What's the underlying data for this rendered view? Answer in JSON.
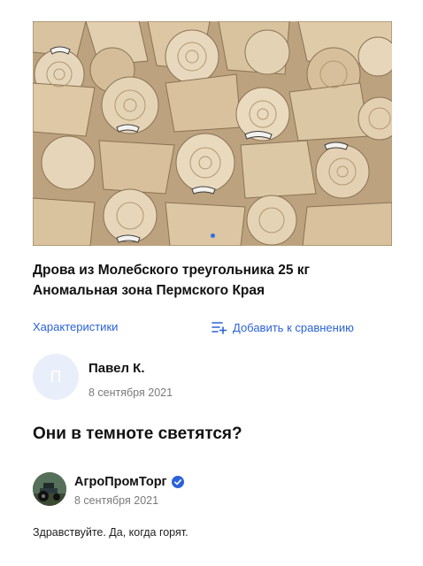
{
  "product": {
    "image_alt_icon": "firewood-photo",
    "title_line1": "Дрова из Молебского треугольника 25 кг",
    "title_line2": "Аномальная зона Пермского Края"
  },
  "actions": {
    "specs_label": "Характеристики",
    "compare_label": "Добавить к сравнению",
    "compare_icon": "add-to-compare-icon"
  },
  "review": {
    "avatar_letter": "П",
    "author": "Павел К.",
    "date": "8 сентября 2021",
    "text": "Они в темноте светятся?"
  },
  "reply": {
    "author": "АгроПромТорг",
    "verified_icon": "verified-badge-icon",
    "date": "8 сентября 2021",
    "text": "Здравствуйте. Да, когда горят."
  },
  "colors": {
    "accent": "#2b62d9",
    "avatar_bg": "#e9eefb",
    "muted_text": "#7a7a7a"
  }
}
